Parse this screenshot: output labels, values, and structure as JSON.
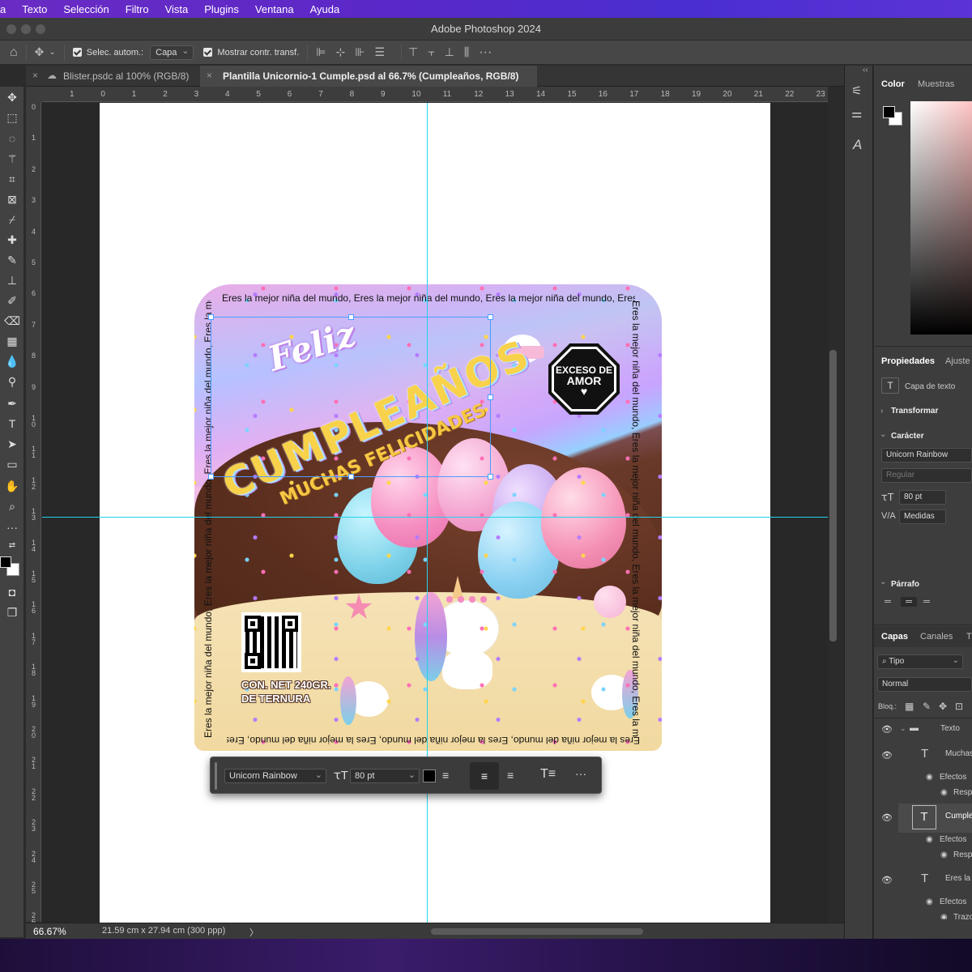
{
  "menubar": {
    "items": [
      "a",
      "Texto",
      "Selección",
      "Filtro",
      "Vista",
      "Plugins",
      "Ventana",
      "Ayuda"
    ]
  },
  "window": {
    "title": "Adobe Photoshop 2024"
  },
  "options": {
    "auto_select_label": "Selec. autom.:",
    "auto_select_value": "Capa",
    "show_transform_label": "Mostrar contr. transf."
  },
  "tabs": [
    {
      "label": "Blister.psdc al 100% (RGB/8)",
      "active": false
    },
    {
      "label": "Plantilla Unicornio-1 Cumple.psd al 66.7% (Cumpleaños, RGB/8)",
      "active": true
    }
  ],
  "ruler": {
    "h": [
      "1",
      "0",
      "1",
      "2",
      "3",
      "4",
      "5",
      "6",
      "7",
      "8",
      "9",
      "10",
      "11",
      "12",
      "13",
      "14",
      "15",
      "16",
      "17",
      "18",
      "19",
      "20",
      "21",
      "22",
      "23"
    ],
    "v": [
      "0",
      "1",
      "2",
      "3",
      "4",
      "5",
      "6",
      "7",
      "8",
      "9",
      "10",
      "11",
      "12",
      "13",
      "14",
      "15",
      "16",
      "17",
      "18",
      "19",
      "20",
      "21",
      "22",
      "23",
      "24",
      "25",
      "26"
    ]
  },
  "design": {
    "feliz": "Feliz",
    "cumpleanos": "CUMPLEAÑOS",
    "muchas": "MUCHAS FELICIDADES",
    "badge_line1": "EXCESO DE",
    "badge_line2": "AMOR",
    "badge_heart": "♥",
    "net_line1": "CON. NET 240GR.",
    "net_line2": "DE TERNURA",
    "border_text": "Eres la mejor niña del mundo, Eres la mejor niña del mundo, Eres la mejor niña del mundo, Eres la mejor niña del mundo, Eres la mejor niña del mundo,"
  },
  "context_toolbar": {
    "font": "Unicorn Rainbow",
    "size": "80 pt",
    "more": "···"
  },
  "status": {
    "zoom": "66.67%",
    "doc_info": "21.59 cm x 27.94 cm (300 ppp)",
    "arrow": "〉"
  },
  "panels": {
    "color_tabs": [
      "Color",
      "Muestras"
    ],
    "props_tabs": [
      "Propiedades",
      "Ajuste"
    ],
    "layer_type": "Capa de texto",
    "transform": "Transformar",
    "character": "Carácter",
    "font": "Unicorn Rainbow",
    "style": "Regular",
    "size": "80 pt",
    "kerning": "Medidas",
    "paragraph": "Párrafo",
    "layers_tabs": [
      "Capas",
      "Canales",
      "T"
    ],
    "filter_kind": "Tipo",
    "blend_mode": "Normal",
    "lock_label": "Bloq.:",
    "layers": [
      {
        "name": "Texto",
        "kind": "group"
      },
      {
        "name": "Muchas",
        "kind": "text"
      },
      {
        "name": "Efectos",
        "kind": "fx"
      },
      {
        "name": "Resp",
        "kind": "fx-item"
      },
      {
        "name": "Cumple",
        "kind": "text",
        "selected": true
      },
      {
        "name": "Efectos",
        "kind": "fx"
      },
      {
        "name": "Resp",
        "kind": "fx-item"
      },
      {
        "name": "Eres la",
        "kind": "text"
      },
      {
        "name": "Efectos",
        "kind": "fx"
      },
      {
        "name": "Trazo",
        "kind": "fx-item"
      }
    ]
  },
  "colors": {
    "guide": "#22d3ee",
    "menubar": "#5a28c8",
    "foreground": "#000000",
    "background": "#ffffff"
  }
}
